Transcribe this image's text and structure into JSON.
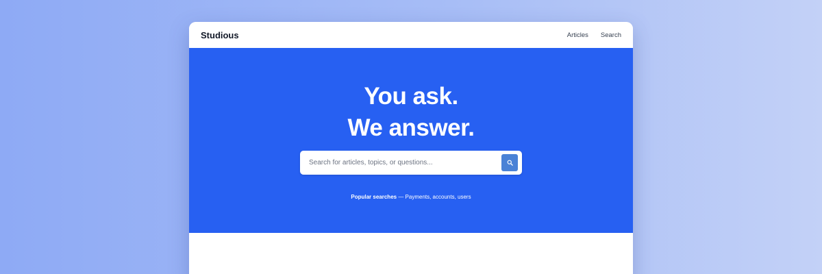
{
  "header": {
    "brand": "Studious",
    "nav": [
      "Articles",
      "Search"
    ]
  },
  "hero": {
    "title_line1": "You ask.",
    "title_line2": "We answer.",
    "search": {
      "placeholder": "Search for articles, topics, or questions...",
      "button_icon": "search-icon"
    },
    "popular": {
      "label": "Popular searches",
      "text": " — Payments, accounts, users"
    }
  },
  "colors": {
    "accent": "#2760f2",
    "search_button": "#4a82d6",
    "background_start": "#8eaaf5",
    "background_end": "#c3d1f7"
  }
}
